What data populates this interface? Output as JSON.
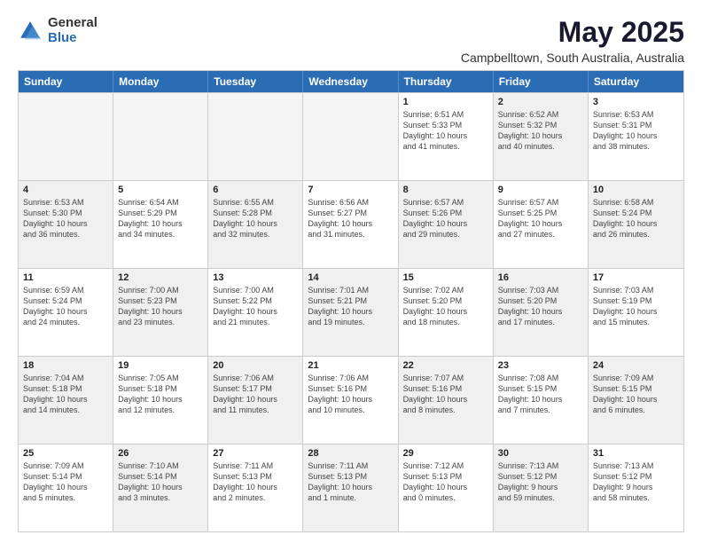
{
  "logo": {
    "general": "General",
    "blue": "Blue"
  },
  "title": "May 2025",
  "subtitle": "Campbelltown, South Australia, Australia",
  "header_days": [
    "Sunday",
    "Monday",
    "Tuesday",
    "Wednesday",
    "Thursday",
    "Friday",
    "Saturday"
  ],
  "weeks": [
    [
      {
        "day": "",
        "info": "",
        "empty": true
      },
      {
        "day": "",
        "info": "",
        "empty": true
      },
      {
        "day": "",
        "info": "",
        "empty": true
      },
      {
        "day": "",
        "info": "",
        "empty": true
      },
      {
        "day": "1",
        "info": "Sunrise: 6:51 AM\nSunset: 5:33 PM\nDaylight: 10 hours\nand 41 minutes."
      },
      {
        "day": "2",
        "info": "Sunrise: 6:52 AM\nSunset: 5:32 PM\nDaylight: 10 hours\nand 40 minutes.",
        "shaded": true
      },
      {
        "day": "3",
        "info": "Sunrise: 6:53 AM\nSunset: 5:31 PM\nDaylight: 10 hours\nand 38 minutes."
      }
    ],
    [
      {
        "day": "4",
        "info": "Sunrise: 6:53 AM\nSunset: 5:30 PM\nDaylight: 10 hours\nand 36 minutes.",
        "shaded": true
      },
      {
        "day": "5",
        "info": "Sunrise: 6:54 AM\nSunset: 5:29 PM\nDaylight: 10 hours\nand 34 minutes."
      },
      {
        "day": "6",
        "info": "Sunrise: 6:55 AM\nSunset: 5:28 PM\nDaylight: 10 hours\nand 32 minutes.",
        "shaded": true
      },
      {
        "day": "7",
        "info": "Sunrise: 6:56 AM\nSunset: 5:27 PM\nDaylight: 10 hours\nand 31 minutes."
      },
      {
        "day": "8",
        "info": "Sunrise: 6:57 AM\nSunset: 5:26 PM\nDaylight: 10 hours\nand 29 minutes.",
        "shaded": true
      },
      {
        "day": "9",
        "info": "Sunrise: 6:57 AM\nSunset: 5:25 PM\nDaylight: 10 hours\nand 27 minutes."
      },
      {
        "day": "10",
        "info": "Sunrise: 6:58 AM\nSunset: 5:24 PM\nDaylight: 10 hours\nand 26 minutes.",
        "shaded": true
      }
    ],
    [
      {
        "day": "11",
        "info": "Sunrise: 6:59 AM\nSunset: 5:24 PM\nDaylight: 10 hours\nand 24 minutes."
      },
      {
        "day": "12",
        "info": "Sunrise: 7:00 AM\nSunset: 5:23 PM\nDaylight: 10 hours\nand 23 minutes.",
        "shaded": true
      },
      {
        "day": "13",
        "info": "Sunrise: 7:00 AM\nSunset: 5:22 PM\nDaylight: 10 hours\nand 21 minutes."
      },
      {
        "day": "14",
        "info": "Sunrise: 7:01 AM\nSunset: 5:21 PM\nDaylight: 10 hours\nand 19 minutes.",
        "shaded": true
      },
      {
        "day": "15",
        "info": "Sunrise: 7:02 AM\nSunset: 5:20 PM\nDaylight: 10 hours\nand 18 minutes."
      },
      {
        "day": "16",
        "info": "Sunrise: 7:03 AM\nSunset: 5:20 PM\nDaylight: 10 hours\nand 17 minutes.",
        "shaded": true
      },
      {
        "day": "17",
        "info": "Sunrise: 7:03 AM\nSunset: 5:19 PM\nDaylight: 10 hours\nand 15 minutes."
      }
    ],
    [
      {
        "day": "18",
        "info": "Sunrise: 7:04 AM\nSunset: 5:18 PM\nDaylight: 10 hours\nand 14 minutes.",
        "shaded": true
      },
      {
        "day": "19",
        "info": "Sunrise: 7:05 AM\nSunset: 5:18 PM\nDaylight: 10 hours\nand 12 minutes."
      },
      {
        "day": "20",
        "info": "Sunrise: 7:06 AM\nSunset: 5:17 PM\nDaylight: 10 hours\nand 11 minutes.",
        "shaded": true
      },
      {
        "day": "21",
        "info": "Sunrise: 7:06 AM\nSunset: 5:16 PM\nDaylight: 10 hours\nand 10 minutes."
      },
      {
        "day": "22",
        "info": "Sunrise: 7:07 AM\nSunset: 5:16 PM\nDaylight: 10 hours\nand 8 minutes.",
        "shaded": true
      },
      {
        "day": "23",
        "info": "Sunrise: 7:08 AM\nSunset: 5:15 PM\nDaylight: 10 hours\nand 7 minutes."
      },
      {
        "day": "24",
        "info": "Sunrise: 7:09 AM\nSunset: 5:15 PM\nDaylight: 10 hours\nand 6 minutes.",
        "shaded": true
      }
    ],
    [
      {
        "day": "25",
        "info": "Sunrise: 7:09 AM\nSunset: 5:14 PM\nDaylight: 10 hours\nand 5 minutes."
      },
      {
        "day": "26",
        "info": "Sunrise: 7:10 AM\nSunset: 5:14 PM\nDaylight: 10 hours\nand 3 minutes.",
        "shaded": true
      },
      {
        "day": "27",
        "info": "Sunrise: 7:11 AM\nSunset: 5:13 PM\nDaylight: 10 hours\nand 2 minutes."
      },
      {
        "day": "28",
        "info": "Sunrise: 7:11 AM\nSunset: 5:13 PM\nDaylight: 10 hours\nand 1 minute.",
        "shaded": true
      },
      {
        "day": "29",
        "info": "Sunrise: 7:12 AM\nSunset: 5:13 PM\nDaylight: 10 hours\nand 0 minutes."
      },
      {
        "day": "30",
        "info": "Sunrise: 7:13 AM\nSunset: 5:12 PM\nDaylight: 9 hours\nand 59 minutes.",
        "shaded": true
      },
      {
        "day": "31",
        "info": "Sunrise: 7:13 AM\nSunset: 5:12 PM\nDaylight: 9 hours\nand 58 minutes."
      }
    ]
  ]
}
